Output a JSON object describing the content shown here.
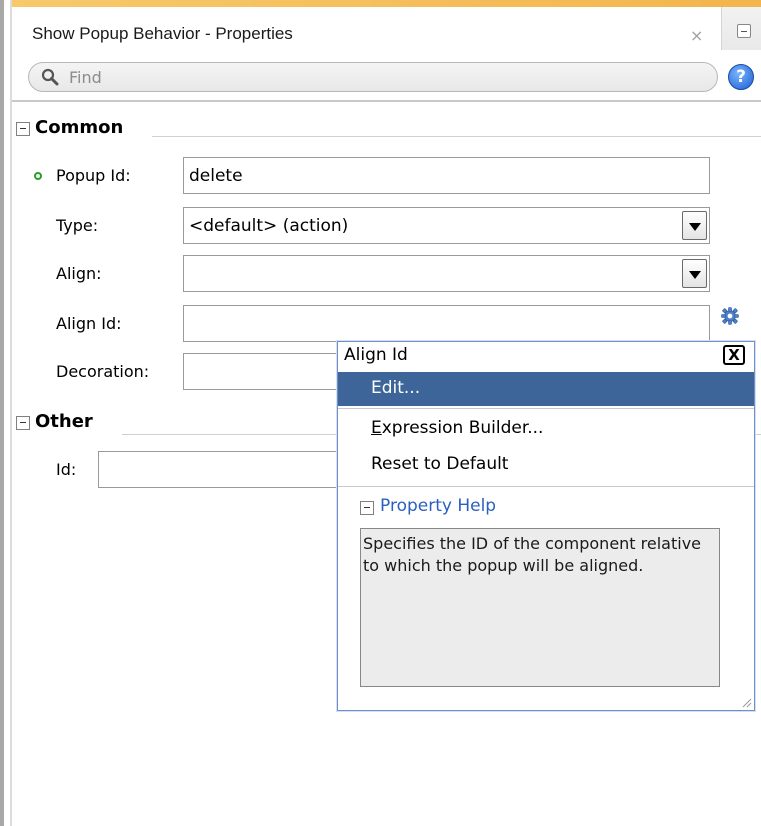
{
  "window": {
    "title": "Show Popup Behavior - Properties",
    "tab_close": "×"
  },
  "search": {
    "placeholder": "Find",
    "help_glyph": "?"
  },
  "sections": {
    "common": "Common",
    "other": "Other"
  },
  "properties": {
    "popup_id": {
      "label": "Popup Id:",
      "value": "delete",
      "required": true
    },
    "type": {
      "label": "Type:",
      "value": "<default> (action)"
    },
    "align": {
      "label": "Align:",
      "value": ""
    },
    "align_id": {
      "label": "Align Id:",
      "value": ""
    },
    "decoration": {
      "label": "Decoration:",
      "value": ""
    },
    "id": {
      "label": "Id:",
      "value": ""
    }
  },
  "popup": {
    "title": "Align Id",
    "close_glyph": "X",
    "menu": {
      "edit": "Edit...",
      "expression_builder_mnemonic": "E",
      "expression_builder_rest": "xpression Builder...",
      "reset": "Reset to Default"
    },
    "help_title": "Property Help",
    "help_text": "Specifies the ID of the component relative to which the popup will be aligned."
  },
  "colors": {
    "accent": "#f3b54d",
    "selection": "#3d6599",
    "link": "#2a5fbf",
    "required_dot": "#28a028"
  }
}
